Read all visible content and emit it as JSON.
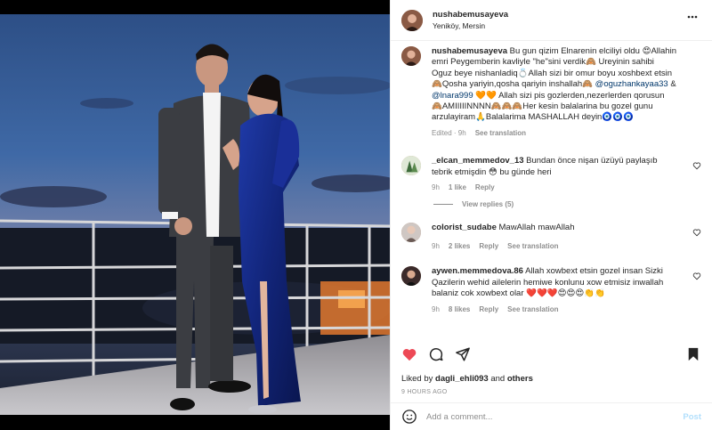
{
  "post": {
    "username": "nushabemusayeva",
    "location": "Yeniköy, Mersin",
    "caption_lines": [
      "Bu gun qizim Elnarenin elciliyi oldu 😍Allahin",
      "emri Peygemberin kavliyle \"he\"sini verdik🙈 Ureyinin sahibi",
      "Oguz beye nishanladiq💍Allah sizi bir omur boyu xoshbext etsin",
      "🙈Qosha yariyin,qosha qariyin inshallah🙈",
      "Allah sizi pis gozlerden,nezerlerden qorusun",
      "🙈AMIIIIINNNN🙈🙈🙈Her kesin balalarina bu gozel gunu",
      "arzulayiram🙏Balalarima MASHALLAH deyin🧿🧿🧿"
    ],
    "mention_1": "@oguzhankayaa33",
    "ampersand": "&",
    "mention_2": "@lnara999",
    "caption_hearts": "🧡🧡",
    "edited": "Edited · 9h",
    "see_translation": "See translation"
  },
  "comments": [
    {
      "username": "_elcan_memmedov_13",
      "text_1": "Bundan önce nişan üzüyü paylaşıb",
      "text_2": "tebrik etmişdin 😳 bu günde heri",
      "time": "9h",
      "likes": "1 like",
      "reply": "Reply",
      "view_replies": "View replies (5)"
    },
    {
      "username": "colorist_sudabe",
      "text_1": "MawAllah mawAllah",
      "time": "9h",
      "likes": "2 likes",
      "reply": "Reply",
      "translation": "See translation"
    },
    {
      "username": "aywen.memmedova.86",
      "text_1": "Allah xowbext etsin gozel insan Sizki",
      "text_2": "Qazilerin wehid ailelerin hemiwe konlunu xow etmisiz inwallah",
      "text_3": "balaniz cok xowbext olar ❤️❤️❤️😍😍😍👏👏",
      "time": "9h",
      "likes": "8 likes",
      "reply": "Reply",
      "translation": "See translation"
    }
  ],
  "likes": {
    "prefix": "Liked by",
    "user": "dagli_ehli093",
    "and": "and",
    "others": "others"
  },
  "time_ago": "9 HOURS AGO",
  "add_comment": {
    "placeholder": "Add a comment...",
    "post_label": "Post"
  },
  "colors": {
    "like_red": "#ed4956",
    "mention_blue": "#00376b",
    "muted_gray": "#8e8e8e",
    "post_button": "#b2dffc"
  },
  "icons": [
    "more-icon",
    "heart-icon",
    "comment-icon",
    "share-icon",
    "bookmark-icon",
    "emoji-icon"
  ]
}
